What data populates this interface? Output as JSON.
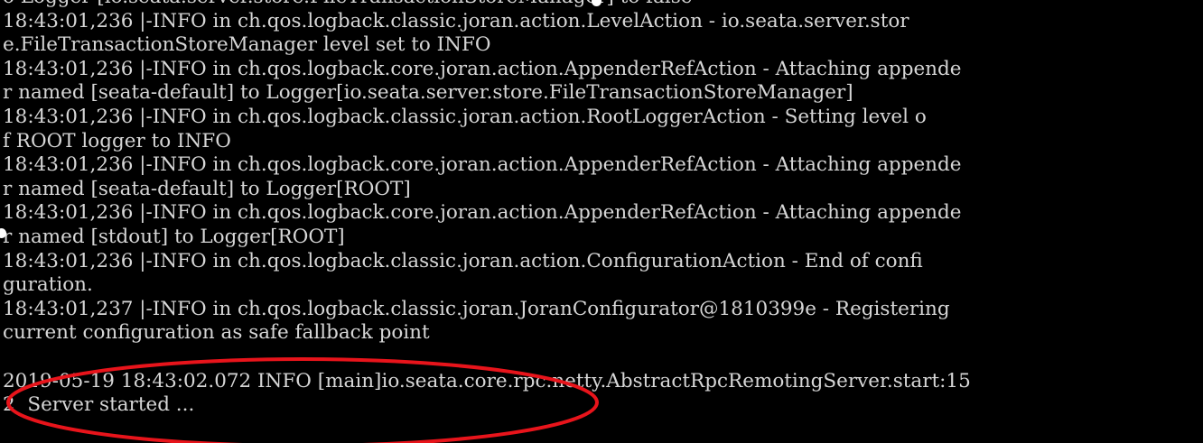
{
  "console": {
    "lines": [
      "o Logger [io.seata.server.store.FileTransactionStoreManager] to false",
      "18:43:01,236 |-INFO in ch.qos.logback.classic.joran.action.LevelAction - io.seata.server.stor",
      "e.FileTransactionStoreManager level set to INFO",
      "18:43:01,236 |-INFO in ch.qos.logback.core.joran.action.AppenderRefAction - Attaching appende",
      "r named [seata-default] to Logger[io.seata.server.store.FileTransactionStoreManager]",
      "18:43:01,236 |-INFO in ch.qos.logback.classic.joran.action.RootLoggerAction - Setting level o",
      "f ROOT logger to INFO",
      "18:43:01,236 |-INFO in ch.qos.logback.core.joran.action.AppenderRefAction - Attaching appende",
      "r named [seata-default] to Logger[ROOT]",
      "18:43:01,236 |-INFO in ch.qos.logback.core.joran.action.AppenderRefAction - Attaching appende",
      "r named [stdout] to Logger[ROOT]",
      "18:43:01,236 |-INFO in ch.qos.logback.classic.joran.action.ConfigurationAction - End of confi",
      "guration.",
      "18:43:01,237 |-INFO in ch.qos.logback.classic.joran.JoranConfigurator@1810399e - Registering",
      "current configuration as safe fallback point",
      "",
      "2019-05-19 18:43:02.072 INFO [main]io.seata.core.rpc.netty.AbstractRpcRemotingServer.start:15",
      "2  Server started ..."
    ]
  },
  "colors": {
    "background": "#000000",
    "text": "#d6d6d6",
    "highlight_ellipse": "#e8141b",
    "marker_dots": "#ffffff"
  }
}
